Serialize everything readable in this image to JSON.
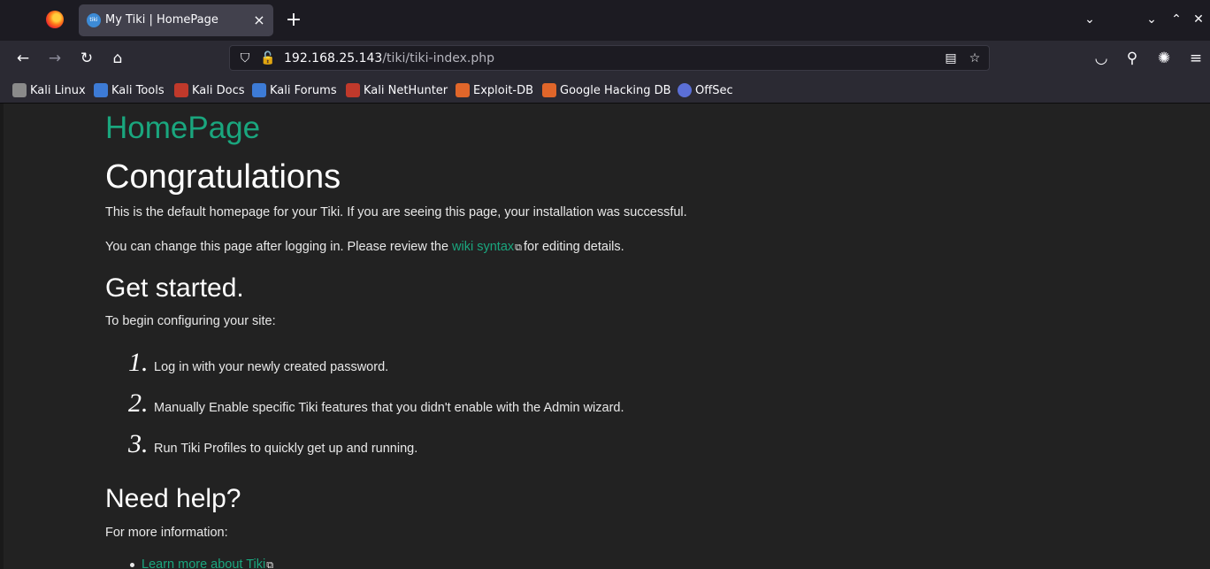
{
  "browser": {
    "tab": {
      "title": "My Tiki | HomePage",
      "favicon_text": "tiki"
    },
    "newtab_label": "+",
    "url": {
      "host": "192.168.25.143",
      "path": "/tiki/tiki-index.php"
    },
    "bookmarks": [
      {
        "label": "Kali Linux",
        "color": "#8a8a8a"
      },
      {
        "label": "Kali Tools",
        "color": "#3d7bd6"
      },
      {
        "label": "Kali Docs",
        "color": "#c0392b"
      },
      {
        "label": "Kali Forums",
        "color": "#3d7bd6"
      },
      {
        "label": "Kali NetHunter",
        "color": "#c0392b"
      },
      {
        "label": "Exploit-DB",
        "color": "#e0662a"
      },
      {
        "label": "Google Hacking DB",
        "color": "#e0662a"
      },
      {
        "label": "OffSec",
        "color": "#5b6fd6"
      }
    ]
  },
  "page": {
    "title": "HomePage",
    "heading": "Congratulations",
    "intro": "This is the default homepage for your Tiki. If you are seeing this page, your installation was successful.",
    "change_prefix": "You can change this page after logging in. Please review the ",
    "wiki_syntax_link": "wiki syntax",
    "change_suffix": "for editing details.",
    "get_started_heading": "Get started.",
    "get_started_intro": "To begin configuring your site:",
    "steps": [
      {
        "num": "1.",
        "pre": "Log in with your newly created password.",
        "link": "",
        "post": ""
      },
      {
        "num": "2.",
        "pre": "Manually ",
        "link": "Enable specific Tiki features",
        "post": " that you didn't enable with the Admin wizard."
      },
      {
        "num": "3.",
        "pre": "Run ",
        "link": "Tiki Profiles",
        "post": " to quickly get up and running."
      }
    ],
    "help_heading": "Need help?",
    "help_intro": "For more information:",
    "help_links": [
      "Learn more about Tiki"
    ]
  },
  "colors": {
    "link": "#1aa67e",
    "background": "#222222",
    "text": "#e8e8e8"
  }
}
